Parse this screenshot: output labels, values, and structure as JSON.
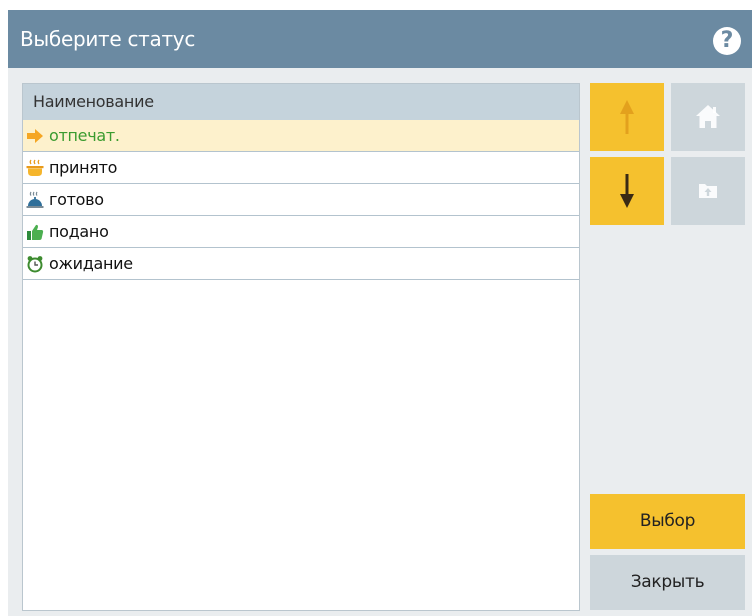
{
  "dialog": {
    "title": "Выберите статус",
    "help_icon": "question-circle-icon"
  },
  "list": {
    "column_header": "Наименование",
    "items": [
      {
        "label": "отпечат.",
        "icon": "arrow-right-icon",
        "selected": true
      },
      {
        "label": "принято",
        "icon": "hot-pot-icon",
        "selected": false
      },
      {
        "label": "готово",
        "icon": "serving-cloche-icon",
        "selected": false
      },
      {
        "label": "подано",
        "icon": "thumbs-up-icon",
        "selected": false
      },
      {
        "label": "ожидание",
        "icon": "alarm-clock-icon",
        "selected": false
      }
    ]
  },
  "side_buttons": {
    "move_up_icon": "arrow-up-icon",
    "move_down_icon": "arrow-down-icon",
    "home_icon": "home-icon",
    "folder_up_icon": "folder-up-icon"
  },
  "actions": {
    "select_label": "Выбор",
    "close_label": "Закрыть"
  },
  "colors": {
    "titlebar": "#6b8aa2",
    "accent": "#f5c12e",
    "selected_row": "#fdf1cc",
    "selected_text": "#3a9b2f",
    "header": "#c5d3dc"
  }
}
